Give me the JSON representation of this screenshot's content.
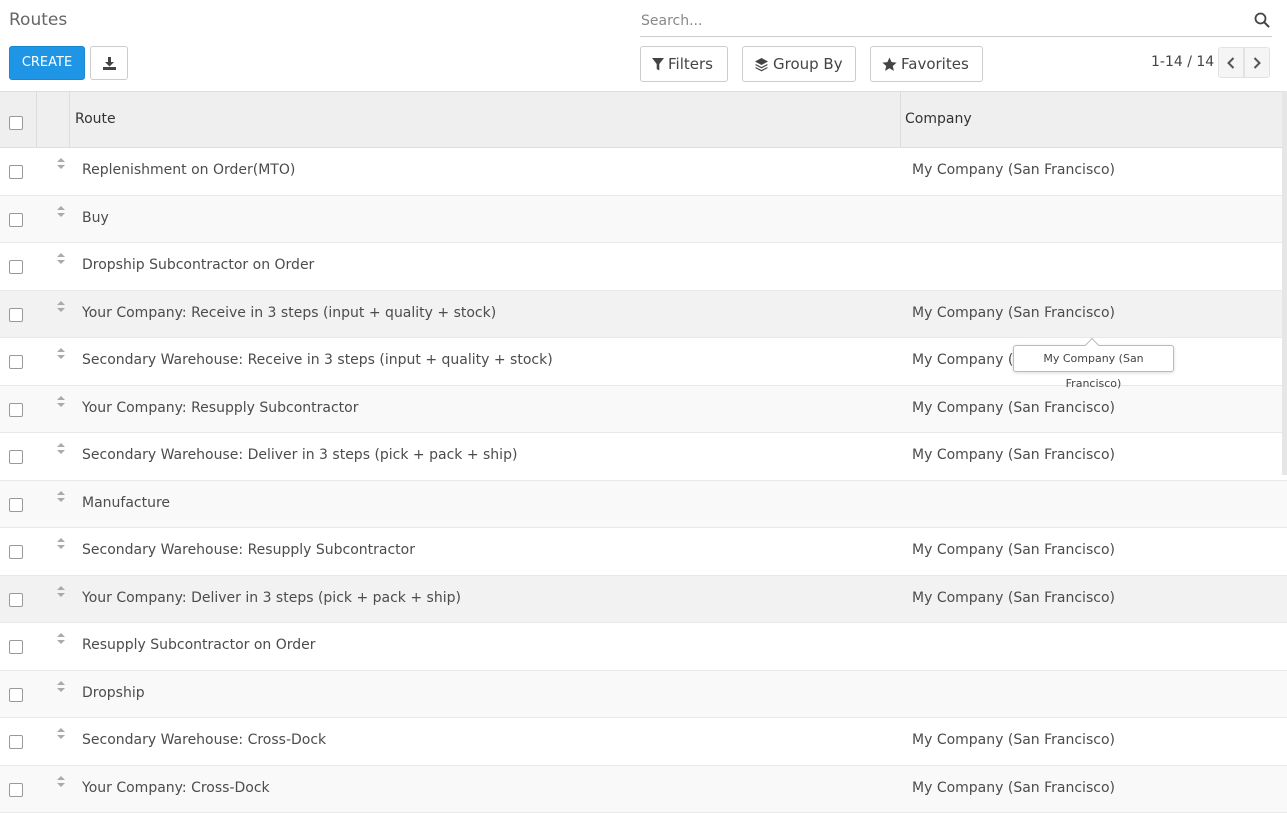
{
  "header": {
    "title": "Routes",
    "search_placeholder": "Search...",
    "create_label": "CREATE",
    "filters_label": "Filters",
    "groupby_label": "Group By",
    "favorites_label": "Favorites",
    "pager": "1-14 / 14"
  },
  "table": {
    "columns": [
      "Route",
      "Company"
    ],
    "rows": [
      {
        "route": "Replenishment on Order(MTO)",
        "company": "My Company (San Francisco)"
      },
      {
        "route": "Buy",
        "company": ""
      },
      {
        "route": "Dropship Subcontractor on Order",
        "company": ""
      },
      {
        "route": "Your Company: Receive in 3 steps (input + quality + stock)",
        "company": "My Company (San Francisco)"
      },
      {
        "route": "Secondary Warehouse: Receive in 3 steps (input + quality + stock)",
        "company": "My Company (San Francisco)"
      },
      {
        "route": "Your Company: Resupply Subcontractor",
        "company": "My Company (San Francisco)"
      },
      {
        "route": "Secondary Warehouse: Deliver in 3 steps (pick + pack + ship)",
        "company": "My Company (San Francisco)"
      },
      {
        "route": "Manufacture",
        "company": ""
      },
      {
        "route": "Secondary Warehouse: Resupply Subcontractor",
        "company": "My Company (San Francisco)"
      },
      {
        "route": "Your Company: Deliver in 3 steps (pick + pack + ship)",
        "company": "My Company (San Francisco)"
      },
      {
        "route": "Resupply Subcontractor on Order",
        "company": ""
      },
      {
        "route": "Dropship",
        "company": ""
      },
      {
        "route": "Secondary Warehouse: Cross-Dock",
        "company": "My Company (San Francisco)"
      },
      {
        "route": "Your Company: Cross-Dock",
        "company": "My Company (San Francisco)"
      }
    ]
  },
  "tooltip": {
    "text": "My Company (San Francisco)"
  },
  "colors": {
    "primary": "#1f95e5",
    "header_bg": "#efefef"
  },
  "icons": {
    "search": "search-icon",
    "download": "download-icon",
    "filter": "filter-icon",
    "group_by": "layers-icon",
    "favorites": "star-icon",
    "pager_prev": "chevron-left-icon",
    "pager_next": "chevron-right-icon",
    "row_handle": "drag-handle-icon"
  }
}
